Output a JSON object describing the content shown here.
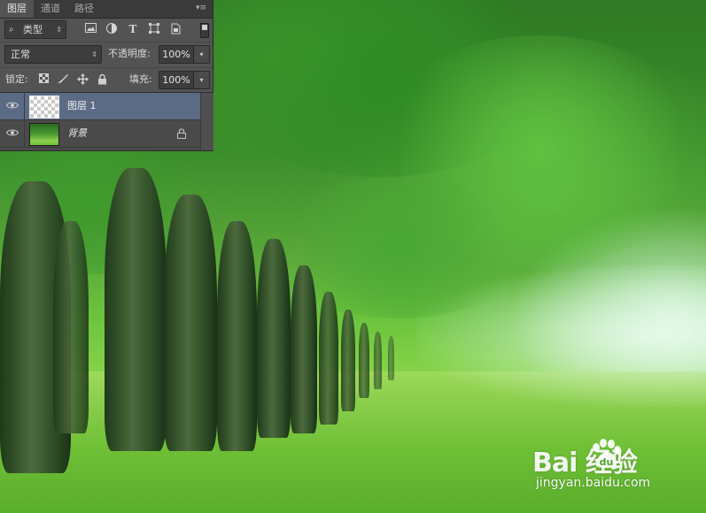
{
  "tabs": [
    {
      "label": "图层",
      "active": true
    },
    {
      "label": "通道",
      "active": false
    },
    {
      "label": "路径",
      "active": false
    }
  ],
  "filter": {
    "kind_label": "类型",
    "icons": [
      "image-filter-icon",
      "adjustment-filter-icon",
      "type-filter-icon",
      "shape-filter-icon",
      "smart-object-filter-icon"
    ]
  },
  "blend": {
    "mode": "正常",
    "opacity_label": "不透明度:",
    "opacity_value": "100%"
  },
  "locks": {
    "label": "锁定:",
    "fill_label": "填充:",
    "fill_value": "100%"
  },
  "layers": [
    {
      "name": "图层 1",
      "selected": true,
      "thumbnail": "transparent",
      "locked": false
    },
    {
      "name": "背景",
      "selected": false,
      "thumbnail": "photo",
      "locked": true
    }
  ],
  "watermark": {
    "logo": "Bai  经验",
    "url": "jingyan.baidu.com"
  },
  "colors": {
    "panel_bg": "#535353",
    "selected_layer": "#5b6a85"
  }
}
